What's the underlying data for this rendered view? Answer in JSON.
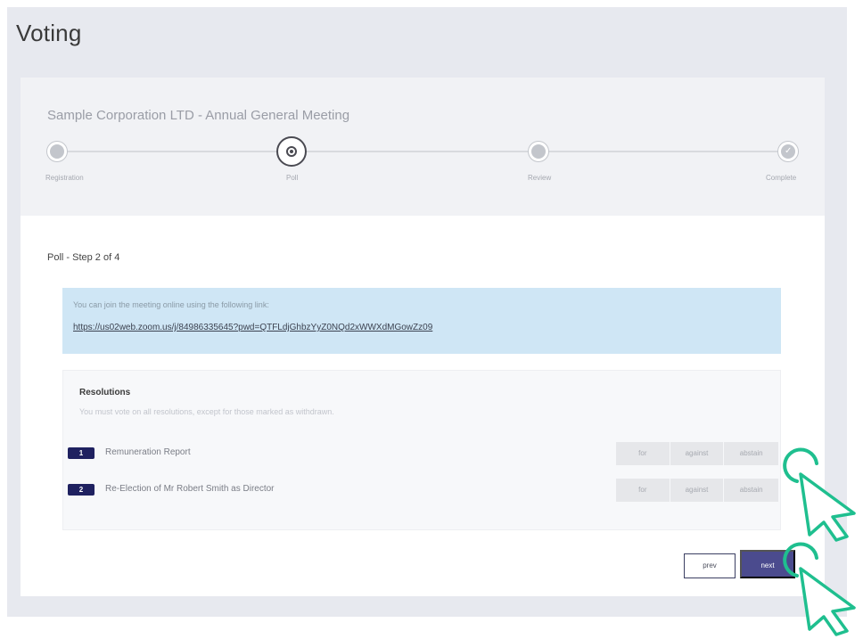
{
  "page": {
    "title": "Voting"
  },
  "meeting": {
    "title": "Sample Corporation LTD - Annual General Meeting"
  },
  "stepper": {
    "steps": [
      {
        "label": "Registration",
        "state": "pending"
      },
      {
        "label": "Poll",
        "state": "active"
      },
      {
        "label": "Review",
        "state": "pending"
      },
      {
        "label": "Complete",
        "state": "done"
      }
    ]
  },
  "poll": {
    "step_text": "Poll - Step 2 of 4"
  },
  "info": {
    "text": "You can join the meeting online using the following link:",
    "link": "https://us02web.zoom.us/j/84986335645?pwd=QTFLdjGhbzYyZ0NQd2xWWXdMGowZz09"
  },
  "resolutions": {
    "title": "Resolutions",
    "note": "You must vote on all resolutions, except for those marked as withdrawn.",
    "items": [
      {
        "number": "1",
        "label": "Remuneration Report",
        "options": [
          "for",
          "against",
          "abstain"
        ]
      },
      {
        "number": "2",
        "label": "Re-Election of Mr Robert Smith as Director",
        "options": [
          "for",
          "against",
          "abstain"
        ]
      }
    ]
  },
  "nav": {
    "prev_label": "prev",
    "next_label": "next"
  },
  "colors": {
    "primary": "#4b4b8e",
    "badge": "#1f2160",
    "info_bg": "#cfe6f5",
    "cursor": "#1fbf8f"
  },
  "icons": {
    "cursor": "pointer-cursor-icon",
    "step_active": "radio-target-icon",
    "step_done": "check-icon"
  }
}
